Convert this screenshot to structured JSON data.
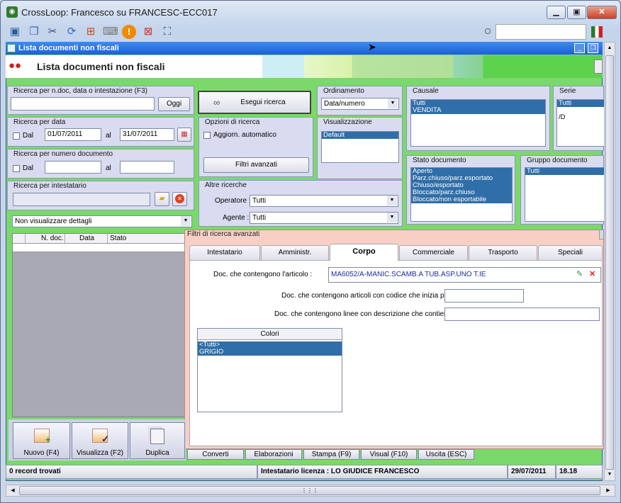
{
  "window": {
    "title": "CrossLoop: Francesco su FRANCESC-ECC017"
  },
  "inner_window": {
    "title": "Lista documenti non fiscali"
  },
  "header": {
    "title": "Lista documenti non fiscali"
  },
  "search_text": {
    "title": "Ricerca per n.doc, data o intestazione (F3)",
    "value": "",
    "oggi_label": "Oggi"
  },
  "search_date": {
    "title": "Ricerca per data",
    "dal_label": "Dal",
    "from": "01/07/2011",
    "al_label": "al",
    "to": "31/07/2011"
  },
  "search_number": {
    "title": "Ricerca per numero documento",
    "dal_label": "Dal",
    "al_label": "al"
  },
  "search_holder": {
    "title": "Ricerca per intestatario"
  },
  "details_select": {
    "value": "Non visualizzare dettagli"
  },
  "execute": {
    "label": "Esegui ricerca"
  },
  "search_options": {
    "title": "Opzioni di ricerca",
    "auto_update": "Aggiorn. automatico",
    "advanced_filters": "Filtri avanzati"
  },
  "ordering": {
    "title": "Ordinamento",
    "value": "Data/numero"
  },
  "display": {
    "title": "Visualizzazione",
    "items": [
      "Default"
    ]
  },
  "other": {
    "title": "Altre ricerche",
    "operator_label": "Operatore :",
    "operator_value": "Tutti",
    "agent_label": "Agente :",
    "agent_value": "Tutti"
  },
  "causale": {
    "title": "Causale",
    "items": [
      "Tutti",
      "VENDITA"
    ]
  },
  "serie": {
    "title": "Serie",
    "items": [
      "Tutti",
      "",
      "/D"
    ]
  },
  "stato": {
    "title": "Stato documento",
    "items": [
      "Aperto",
      "Parz.chiuso/parz.esportato",
      "Chiuso/esportato",
      "Bloccato/parz.chiuso",
      "Bloccato/non esportabile"
    ]
  },
  "gruppo": {
    "title": "Gruppo documento",
    "items": [
      "Tutti"
    ]
  },
  "table": {
    "columns": [
      "N. doc.",
      "Data",
      "Stato"
    ]
  },
  "advanced": {
    "title": "Filtri di ricerca avanzati",
    "tabs": [
      "Intestatario",
      "Amministr.",
      "Corpo",
      "Commerciale",
      "Trasporto",
      "Speciali"
    ],
    "active_tab": "Corpo",
    "article_label": "Doc. che contengono l'articolo :",
    "article_value": "MA6052/A-MANIC.SCAMB.A TUB.ASP.UNO T.IE",
    "code_label": "Doc. che contengono articoli con codice che inizia per :",
    "desc_label": "Doc. che contengono linee con descrizione che contiene :",
    "colors_header": "Colori",
    "colors": [
      "<Tutti>",
      "GRIGIO"
    ]
  },
  "actions": {
    "new": "Nuovo (F4)",
    "view": "Visualizza (F2)",
    "duplicate": "Duplica",
    "convert": "Converti",
    "elaborations": "Elaborazioni",
    "print": "Stampa (F9)",
    "visual": "Visual (F10)",
    "exit": "Uscita (ESC)"
  },
  "status": {
    "records": "0 record trovati",
    "license": "Intestatario licenza : LO GIUDICE FRANCESCO",
    "date": "29/07/2011",
    "time": "18.18"
  }
}
